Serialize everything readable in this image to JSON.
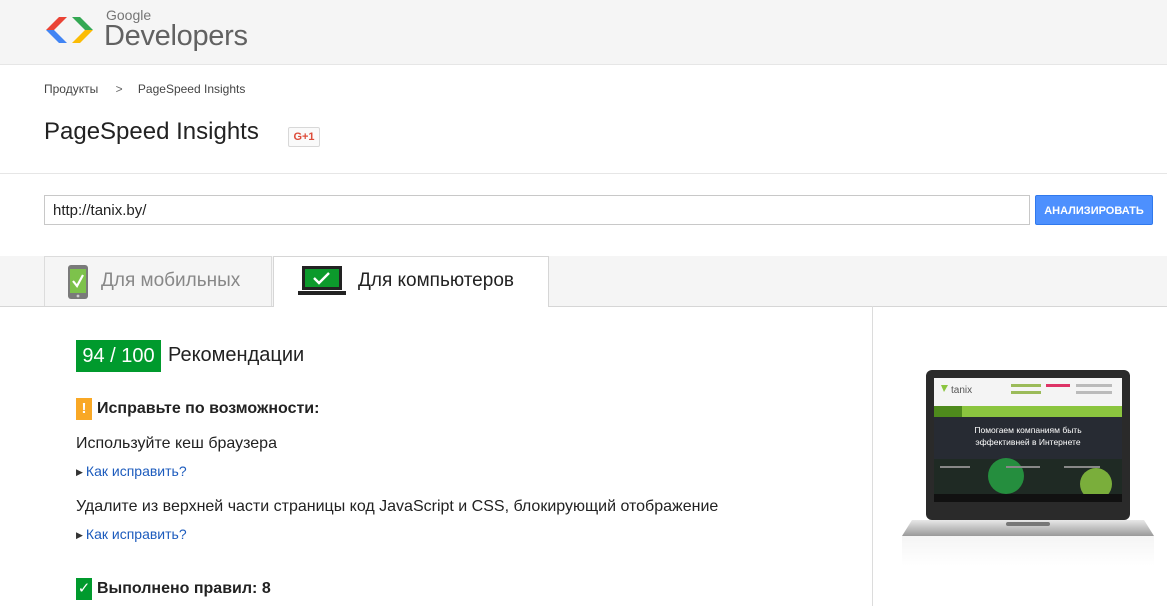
{
  "header": {
    "logo_top": "Google",
    "logo_bottom": "Developers"
  },
  "breadcrumb": {
    "items": [
      "Продукты",
      "PageSpeed Insights"
    ],
    "separator": ">"
  },
  "page": {
    "title": "PageSpeed Insights",
    "gplus_label": "G+1"
  },
  "url_form": {
    "value": "http://tanix.by/",
    "button_label": "АНАЛИЗИРОВАТЬ"
  },
  "tabs": [
    {
      "label": "Для мобильных",
      "selected": false,
      "icon": "mobile-phone-icon"
    },
    {
      "label": "Для компьютеров",
      "selected": true,
      "icon": "desktop-monitor-icon"
    }
  ],
  "results": {
    "score": "94 / 100",
    "score_label": "Рекомендации",
    "score_color": "#009a2d",
    "warning_badge": "!",
    "warning_heading": "Исправьте по возможности:",
    "rules": [
      {
        "text": "Используйте кеш браузера",
        "link": "Как исправить?"
      },
      {
        "text": "Удалите из верхней части страницы код JavaScript и CSS, блокирующий отображение",
        "link": "Как исправить?"
      }
    ],
    "passed_badge": "✓",
    "passed_heading": "Выполнено правил: 8"
  },
  "preview": {
    "site_logo": "tanix",
    "headline_1": "Помогаем компаниям быть",
    "headline_2": "эффективней в Интернете",
    "nav": [
      "ГЛАВНАЯ",
      "О НАС",
      "ИНСТРУМЕНТЫ",
      "УСЛУГИ",
      "ПОРТФОЛИО",
      "БЛОГ",
      "КОНТАКТЫ"
    ]
  },
  "colors": {
    "accent_blue": "#4d90fe",
    "success_green": "#009a2d",
    "warning_orange": "#f9a825",
    "link_blue": "#1c5bbd"
  }
}
